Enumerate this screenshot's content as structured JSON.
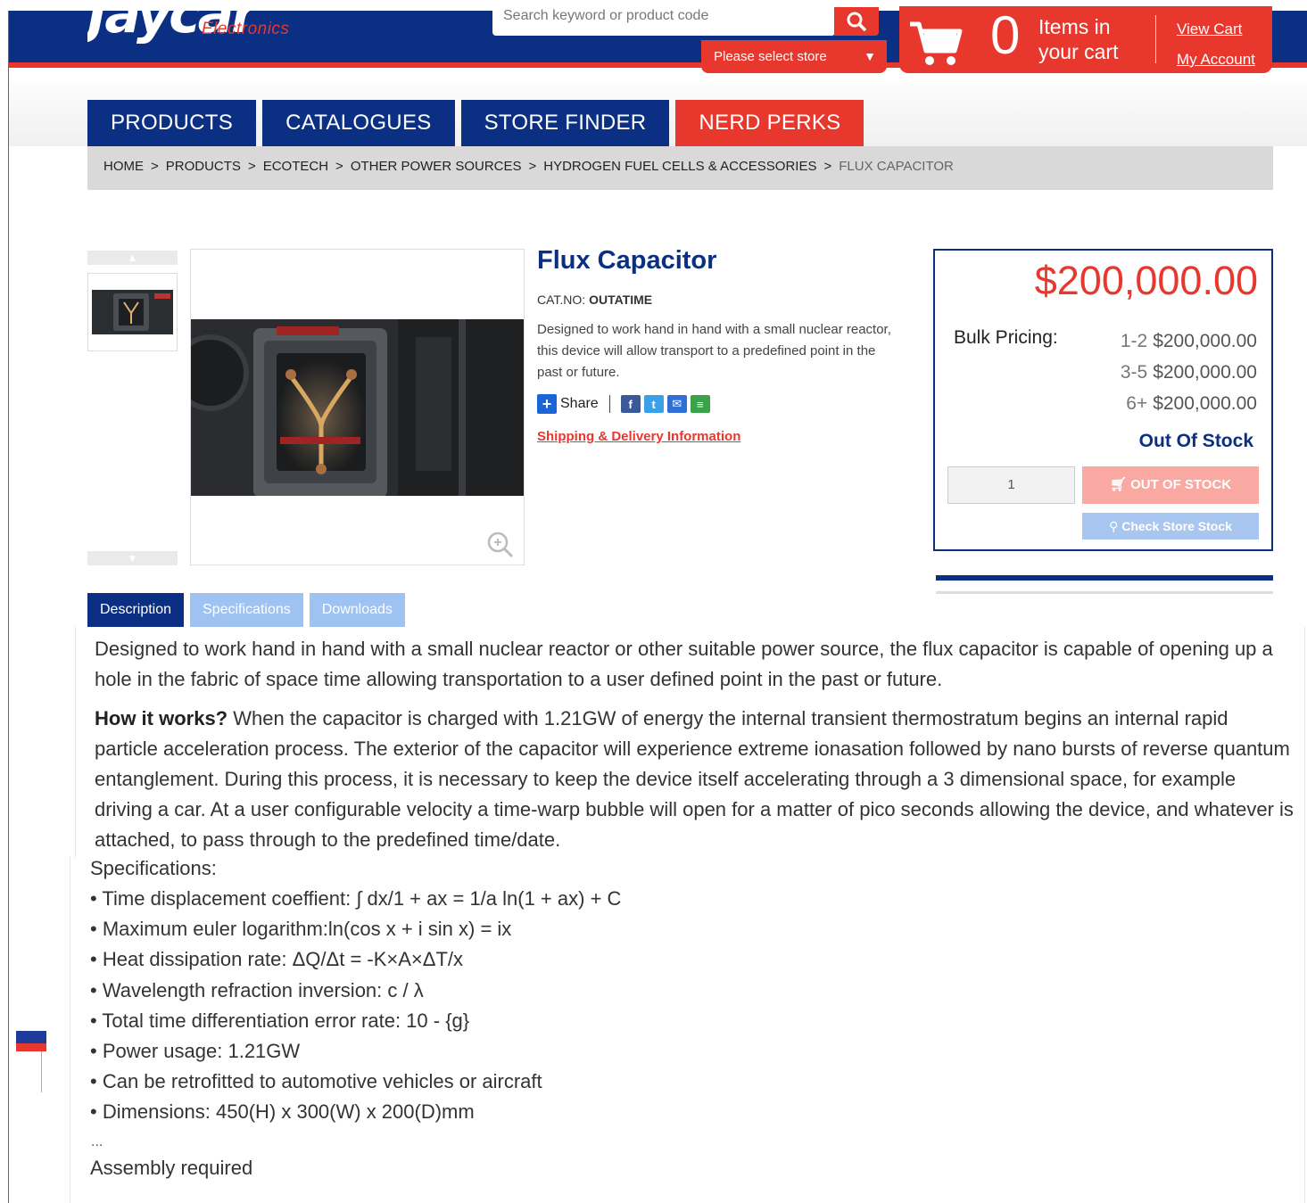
{
  "header": {
    "logo_text": "Jaycar",
    "logo_sub": "Electronics",
    "search_placeholder": "Search keyword or product code",
    "store_select": "Please select store",
    "cart": {
      "count": "0",
      "text": "Items in your cart",
      "view_cart": "View Cart",
      "my_account": "My Account"
    }
  },
  "nav": {
    "items": [
      "PRODUCTS",
      "CATALOGUES",
      "STORE FINDER",
      "NERD PERKS"
    ]
  },
  "breadcrumb": {
    "items": [
      "HOME",
      "PRODUCTS",
      "ECOTECH",
      "OTHER POWER SOURCES",
      "HYDROGEN FUEL CELLS & ACCESSORIES",
      "FLUX CAPACITOR"
    ],
    "separator": ">"
  },
  "product": {
    "title": "Flux Capacitor",
    "cat_label": "CAT.NO:",
    "cat_no": "OUTATIME",
    "short_description": "Designed to work hand in hand with a small nuclear reactor, this device will allow transport to a predefined point in the past or future.",
    "share_label": "Share",
    "shipping_link": "Shipping & Delivery Information"
  },
  "pricing": {
    "price": "$200,000.00",
    "bulk_label": "Bulk Pricing:",
    "bulk": [
      {
        "qty": "1-2",
        "price": "$200,000.00"
      },
      {
        "qty": "3-5",
        "price": "$200,000.00"
      },
      {
        "qty": "6+",
        "price": "$200,000.00"
      }
    ],
    "stock_status": "Out Of Stock",
    "quantity": "1",
    "out_of_stock_button": "OUT OF STOCK",
    "check_store_button": "Check Store Stock"
  },
  "tabs": [
    "Description",
    "Specifications",
    "Downloads"
  ],
  "description": {
    "para1": "Designed to work hand in hand with a small nuclear reactor or other suitable power source, the flux capacitor is capable of opening up a hole in the fabric of space time allowing transportation to a user defined point in the past or future.",
    "how_label": "How it works?",
    "para2": " When the capacitor is charged with 1.21GW of energy the internal transient thermostratum begins an internal rapid particle acceleration process. The exterior of the capacitor will experience extreme ionasation followed by nano bursts of reverse quantum entanglement. During this process, it is necessary to keep the device itself accelerating through a 3 dimensional space, for example driving a car. At a user configurable velocity a time-warp bubble will open for a matter of pico seconds allowing the device, and whatever is attached, to pass through to the predefined time/date.",
    "spec_title": "Specifications:",
    "specs": [
      "Time displacement coeffient: ∫ dx/1 + ax = 1/a ln(1 + ax) + C",
      "Maximum euler logarithm:ln(cos x + i sin x) = ix",
      "Heat dissipation rate: ΔQ/Δt = -K×A×ΔT/x",
      "Wavelength refraction inversion: c / λ",
      "Total time differentiation error rate: 10 - {g}",
      "Power usage: 1.21GW",
      "Can be retrofitted to automotive vehicles or aircraft",
      "Dimensions: 450(H) x 300(W) x 200(D)mm"
    ],
    "dots": "...",
    "assembly": "Assembly required"
  },
  "colors": {
    "brand_blue": "#0b2f82",
    "brand_red": "#e8372d"
  }
}
